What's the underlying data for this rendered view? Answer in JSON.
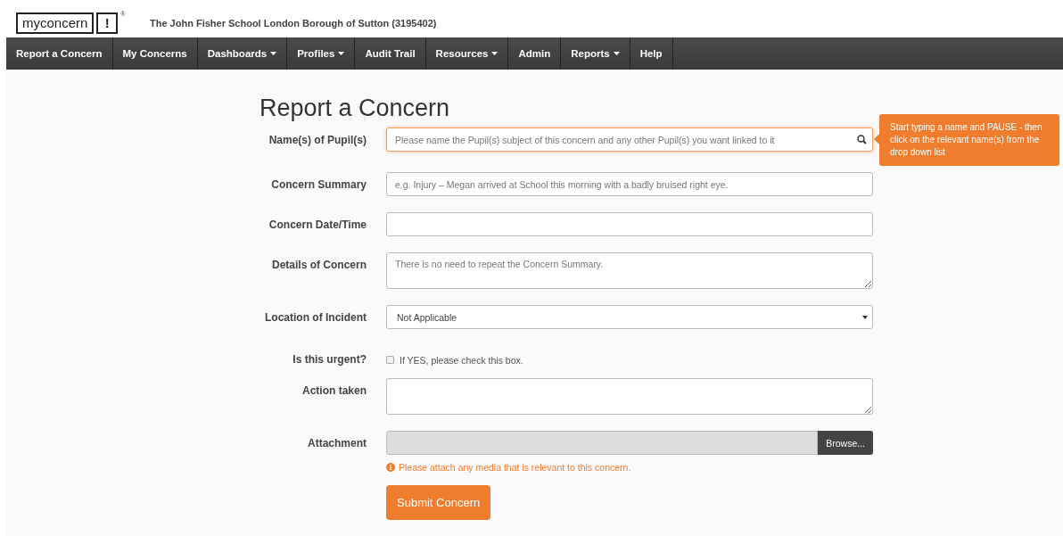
{
  "header": {
    "logo": {
      "wordmark": "myconcern",
      "exclaim": "!",
      "mark": "®"
    },
    "school": "The John Fisher School London Borough of Sutton (3195402)"
  },
  "nav": [
    {
      "label": "Report a Concern",
      "caret": false
    },
    {
      "label": "My Concerns",
      "caret": false
    },
    {
      "label": "Dashboards",
      "caret": true
    },
    {
      "label": "Profiles",
      "caret": true
    },
    {
      "label": "Audit Trail",
      "caret": false
    },
    {
      "label": "Resources",
      "caret": true
    },
    {
      "label": "Admin",
      "caret": false
    },
    {
      "label": "Reports",
      "caret": true
    },
    {
      "label": "Help",
      "caret": false
    }
  ],
  "form": {
    "title": "Report a Concern",
    "fields": [
      {
        "kind": "search",
        "label": "Name(s) of Pupil(s)",
        "placeholder": "Please name the Pupil(s) subject of this concern and any other Pupil(s) you want linked to it",
        "focused": true,
        "tooltip": "Start typing a name and PAUSE - then click on the relevant name(s) from the drop down list"
      },
      {
        "kind": "text",
        "label": "Concern Summary",
        "placeholder": "e.g. Injury – Megan arrived at School this morning with a badly bruised right eye.",
        "focused": false
      },
      {
        "kind": "text",
        "label": "Concern Date/Time",
        "focused": false
      },
      {
        "kind": "textarea",
        "label": "Details of Concern",
        "placeholder": "There is no need to repeat the Concern Summary.",
        "focused": false
      },
      {
        "kind": "select",
        "label": "Location of Incident",
        "value": "Not Applicable",
        "focused": false
      },
      {
        "kind": "checkbox",
        "label": "Is this urgent?",
        "text": "If YES, please check this box.",
        "checked": false
      },
      {
        "kind": "textarea",
        "label": "Action taken",
        "focused": false
      },
      {
        "kind": "file",
        "label": "Attachment",
        "button": "Browse...",
        "hint": "Please attach any media that is relevant to this concern."
      }
    ],
    "submit": "Submit Concern"
  }
}
